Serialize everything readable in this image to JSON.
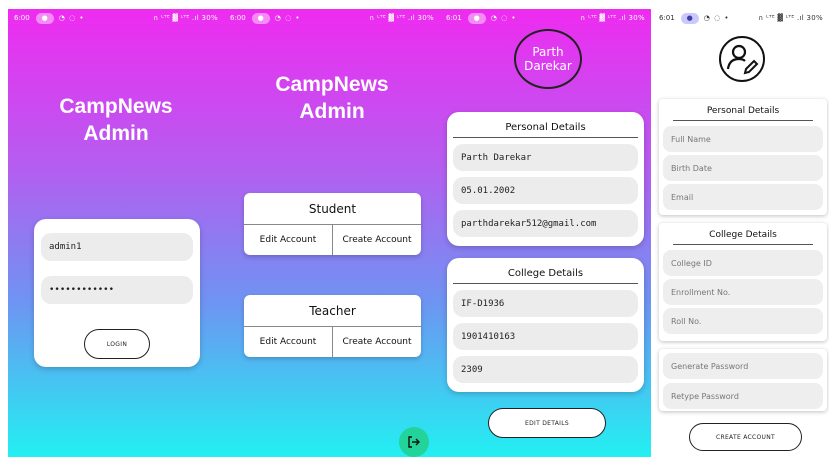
{
  "statusbar": [
    {
      "time": "6:00",
      "right": "∩ ᴸᵀᴱ ▓ ᴸᵀᴱ .ıl 30%"
    },
    {
      "time": "6:00",
      "right": "∩ ᴸᵀᴱ ▓ ᴸᵀᴱ .ıl 30%"
    },
    {
      "time": "6:01",
      "right": "∩ ᴸᵀᴱ ▓ ᴸᵀᴱ .ıl 30%"
    },
    {
      "time": "6:01",
      "right": "∩ ᴸᵀᴱ ▓ ᴸᵀᴱ .ıl 30%"
    }
  ],
  "login": {
    "title_line1": "CampNews",
    "title_line2": "Admin",
    "username": "admin1",
    "password": "••••••••••••",
    "button": "LOGIN"
  },
  "dashboard": {
    "title_line1": "CampNews",
    "title_line2": "Admin",
    "student": {
      "title": "Student",
      "edit": "Edit Account",
      "create": "Create Account"
    },
    "teacher": {
      "title": "Teacher",
      "edit": "Edit Account",
      "create": "Create Account"
    },
    "logout_icon": "logout-icon"
  },
  "profile": {
    "avatar_line1": "Parth",
    "avatar_line2": "Darekar",
    "personal_title": "Personal Details",
    "name": "Parth Darekar",
    "dob": "05.01.2002",
    "email": "parthdarekar512@gmail.com",
    "college_title": "College Details",
    "college_id": "IF-D1936",
    "enrollment": "1901410163",
    "roll": "2309",
    "button": "EDIT DETAILS"
  },
  "create_account": {
    "avatar_icon": "user-edit-icon",
    "personal_title": "Personal Details",
    "full_name_ph": "Full Name",
    "birth_date_ph": "Birth Date",
    "email_ph": "Email",
    "college_title": "College Details",
    "college_id_ph": "College ID",
    "enrollment_ph": "Enrollment No.",
    "roll_ph": "Roll No.",
    "generate_pw_ph": "Generate Password",
    "retype_pw_ph": "Retype Password",
    "button": "CREATE ACCOUNT"
  },
  "colors": {
    "gradient_top": "#ef2bf0",
    "gradient_bottom": "#22f0f2",
    "fab": "#22d39a"
  }
}
